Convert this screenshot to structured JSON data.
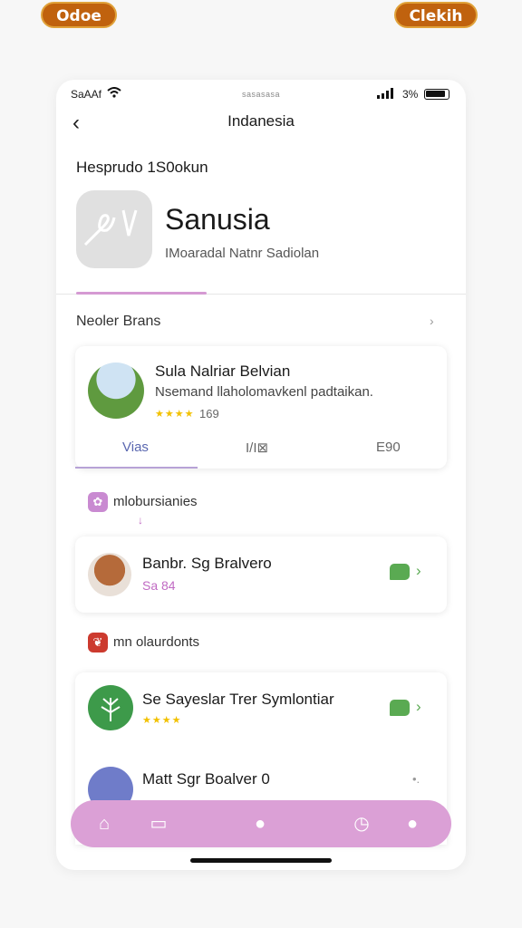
{
  "badges": {
    "left": "Odoe",
    "right": "Clekih"
  },
  "status_bar": {
    "carrier": "SaAAf",
    "center": "sasasasa",
    "battery": "3%"
  },
  "nav": {
    "title": "Indanesia",
    "back_icon": "chevron-left-icon"
  },
  "header": {
    "section": "Hesprudo 1S0okun"
  },
  "profile": {
    "name": "Sanusia",
    "subtitle": "IMoaradal Natnr Sadiolan"
  },
  "recommendations": {
    "header": "Neoler Brans",
    "featured": {
      "title": "Sula Nalriar Belvian",
      "description": "Nsemand llaholomavkenl padtaikan.",
      "stars": "★★★★",
      "rating": "169",
      "tabs": [
        "Vias",
        "I/I⊠",
        "E90"
      ]
    }
  },
  "groups": [
    {
      "label": "mlobursianies",
      "mark": "↓",
      "items": [
        {
          "title": "Banbr. Sg Bralvero",
          "subtitle": "Sa 84"
        }
      ]
    },
    {
      "label": "mn olaurdonts",
      "items": [
        {
          "title": "Se Sayeslar Trer Symlontiar",
          "stars": "★★★★"
        },
        {
          "title": "Matt Sgr Boalver 0",
          "more": "•."
        }
      ]
    }
  ],
  "bottom_nav": [
    "home-icon",
    "library-icon",
    "center-action-icon",
    "history-icon",
    "profile-icon"
  ],
  "colors": {
    "accent": "#dba0d6",
    "brand_orange": "#c0620e",
    "green": "#5aaa52",
    "star": "#f2c100"
  }
}
